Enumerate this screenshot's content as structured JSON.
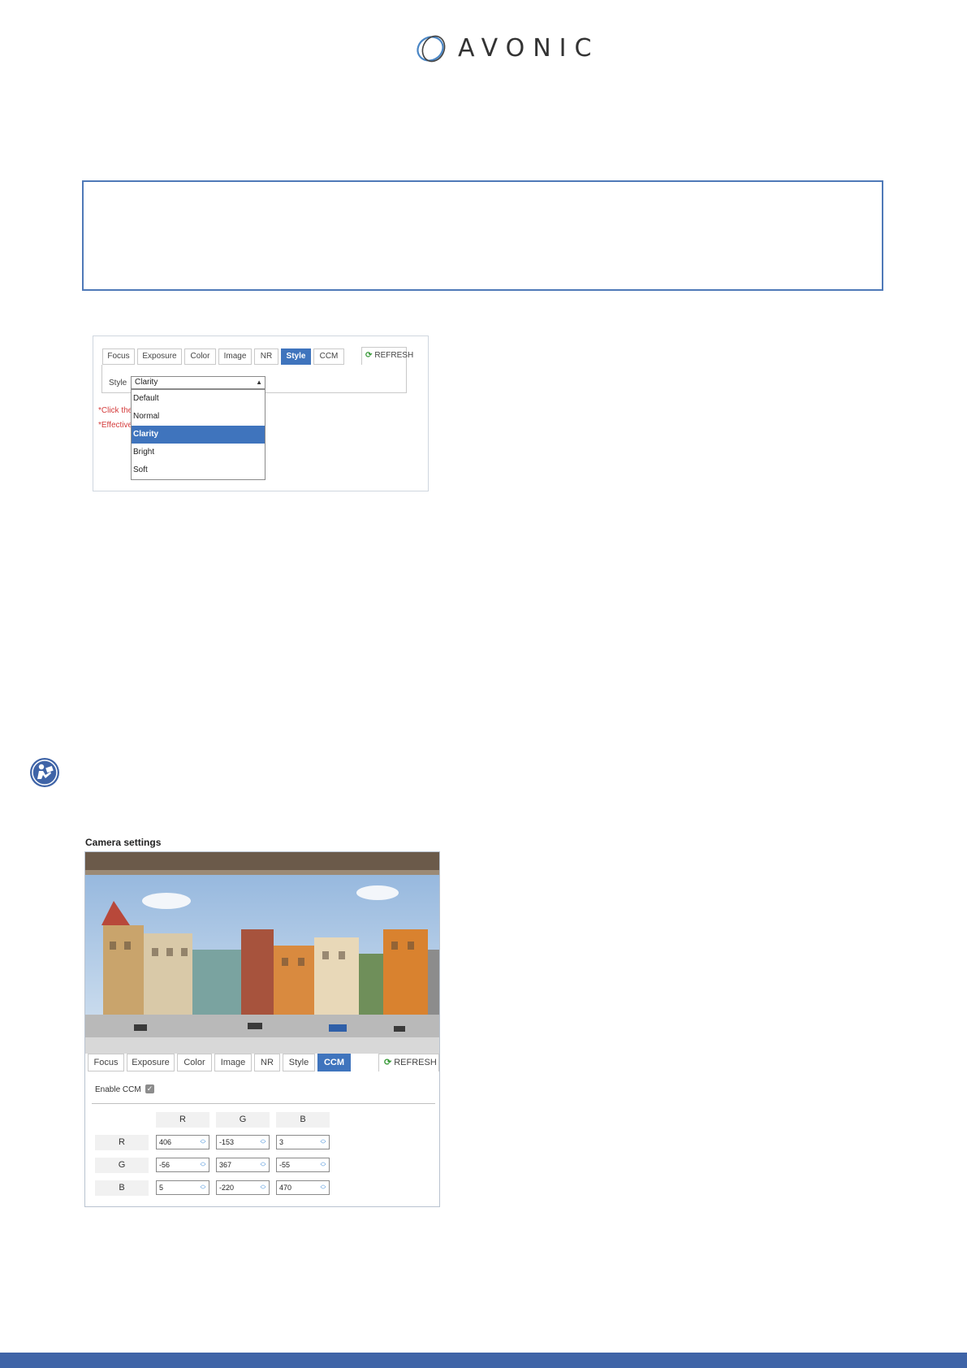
{
  "header": {
    "brand": "AVONIC",
    "colors": {
      "logo_stroke": "#4a86c5"
    }
  },
  "style_screenshot": {
    "tabs": [
      {
        "label": "Focus",
        "active": false
      },
      {
        "label": "Exposure",
        "active": false
      },
      {
        "label": "Color",
        "active": false
      },
      {
        "label": "Image",
        "active": false
      },
      {
        "label": "NR",
        "active": false
      },
      {
        "label": "Style",
        "active": true
      },
      {
        "label": "CCM",
        "active": false
      }
    ],
    "refresh_label": "REFRESH",
    "style_label": "Style",
    "selected_value": "Clarity",
    "options": [
      "Default",
      "Normal",
      "Clarity",
      "Bright",
      "Soft"
    ],
    "selected_index": 2,
    "note1": "*Click the",
    "note2": "*Effective"
  },
  "ccm_screenshot": {
    "title": "Camera settings",
    "tabs": [
      {
        "label": "Focus",
        "active": false
      },
      {
        "label": "Exposure",
        "active": false
      },
      {
        "label": "Color",
        "active": false
      },
      {
        "label": "Image",
        "active": false
      },
      {
        "label": "NR",
        "active": false
      },
      {
        "label": "Style",
        "active": false
      },
      {
        "label": "CCM",
        "active": true
      }
    ],
    "refresh_label": "REFRESH",
    "enable_label": "Enable CCM",
    "enable_checked": true,
    "columns": [
      "R",
      "G",
      "B"
    ],
    "rows": [
      {
        "label": "R",
        "values": [
          "406",
          "-153",
          "3"
        ]
      },
      {
        "label": "G",
        "values": [
          "-56",
          "367",
          "-55"
        ]
      },
      {
        "label": "B",
        "values": [
          "5",
          "-220",
          "470"
        ]
      }
    ]
  },
  "colors": {
    "accent": "#3f74bd",
    "footer": "#3f64a7",
    "note_red": "#d43b3b",
    "box_border": "#4f79b8"
  },
  "icons": {
    "info": "reading-person-icon",
    "refresh": "refresh-icon"
  }
}
